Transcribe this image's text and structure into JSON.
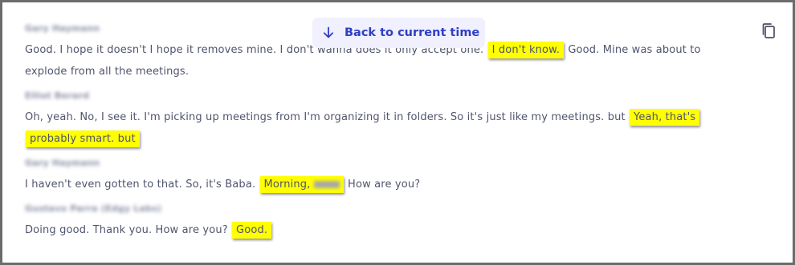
{
  "jump_button": {
    "label": "Back to current time",
    "icon": "arrow-down-icon"
  },
  "copy_button": {
    "icon": "copy-icon"
  },
  "transcript": [
    {
      "speaker": "Gary Haymann",
      "segments": [
        {
          "text": "Good. I hope it doesn't I hope it removes mine. I don't wanna does it only accept one. ",
          "highlight": false
        },
        {
          "text": "I don't know.",
          "highlight": true
        },
        {
          "text": " Good. Mine was about to explode from all the meetings.",
          "highlight": false
        }
      ]
    },
    {
      "speaker": "Elliot Berard",
      "segments": [
        {
          "text": "Oh, yeah. No, I see it. I'm picking up meetings from I'm organizing it in folders. So it's just like my meetings. but ",
          "highlight": false
        },
        {
          "text": "Yeah, that's",
          "highlight": true
        },
        {
          "text": " ",
          "highlight": false
        },
        {
          "text": "probably smart. but",
          "highlight": true
        }
      ]
    },
    {
      "speaker": "Gary Haymann",
      "segments": [
        {
          "text": "I haven't even gotten to that. So, it's Baba. ",
          "highlight": false
        },
        {
          "text": "Morning, ",
          "highlight": true,
          "redacted": true
        },
        {
          "text": " How are you?",
          "highlight": false
        }
      ]
    },
    {
      "speaker": "Gustavo Parra (Edgy Labs)",
      "segments": [
        {
          "text": "Doing good. Thank you. How are you? ",
          "highlight": false
        },
        {
          "text": "Good.",
          "highlight": true
        }
      ]
    }
  ],
  "colors": {
    "highlight": "#ffff00",
    "accent": "#2e3fc4",
    "button_bg": "#f0f0fe",
    "text": "#50546e",
    "speaker": "#8a8ea3"
  }
}
